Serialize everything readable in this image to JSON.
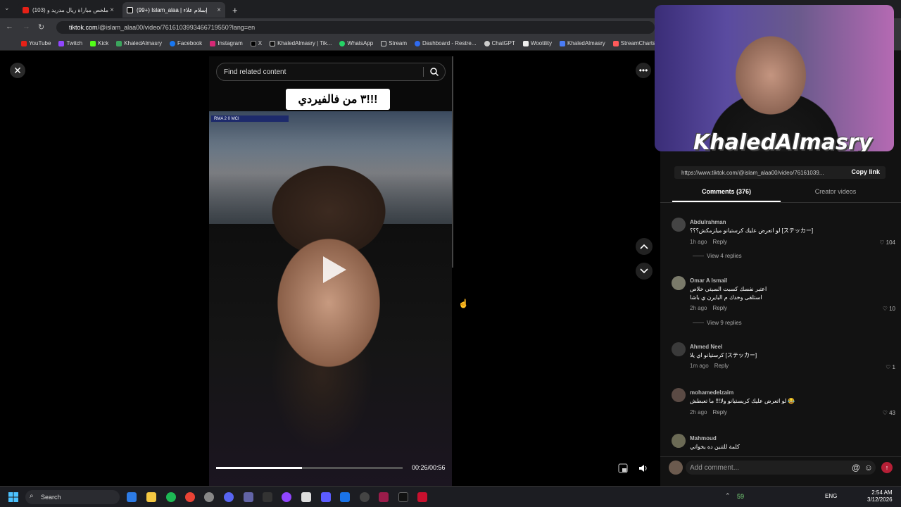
{
  "browser": {
    "tabs": [
      {
        "label": "(103) ملخص مباراة ريال مدريد و",
        "color": "#e62117"
      },
      {
        "label": "(99+) Islam_alaa | إسلام علاء",
        "color": "#ffffff"
      }
    ],
    "new_tab": "+",
    "url_host": "tiktok.com",
    "url_path": "/@islam_alaa00/video/7616103993466719550?lang=en",
    "bookmarks": [
      "YouTube",
      "Twitch",
      "Kick",
      "KhaledAlmasry",
      "Facebook",
      "Instagram",
      "X",
      "KhaledAlmasry | Tik...",
      "WhatsApp",
      "Stream",
      "Dashboard - Restre...",
      "ChatGPT",
      "Wootility",
      "KhaledAlmasry",
      "StreamCharts"
    ]
  },
  "video": {
    "search_placeholder": "Find related content",
    "caption": "٣ من فالفيردي!!!",
    "scorebug": "RMA 2 0 MCI",
    "time": "00:26/00:56",
    "progress": 0.46
  },
  "panel": {
    "link": "https://www.tiktok.com/@islam_alaa00/video/76161039...",
    "copy_link": "Copy link",
    "tab_comments": "Comments (376)",
    "tab_creator": "Creator videos",
    "comment_placeholder": "Add comment...",
    "comments": [
      {
        "user": "Abdulrahman",
        "text": "لو اتعرض عليك كرستيانو ميلزمكش؟؟؟ [ステッカー]",
        "time": "1h ago",
        "reply": "Reply",
        "likes": "104",
        "replies": "View 4 replies"
      },
      {
        "user": "Omar A Ismail",
        "text": "اعتبر نفسك كسبت السيتي خلاص\nاستلقى وخدك م البايرن ي باشا",
        "time": "2h ago",
        "reply": "Reply",
        "likes": "10",
        "replies": "View 9 replies"
      },
      {
        "user": "Ahmed Neel",
        "text": "كرستيانو اي يلا [ステッカー]",
        "time": "1m ago",
        "reply": "Reply",
        "likes": "1",
        "replies": ""
      },
      {
        "user": "mohamedelzaim",
        "text": "لو اتعرض عليك كريستيانو ولا!!! ما تعبطش 😂",
        "time": "2h ago",
        "reply": "Reply",
        "likes": "43",
        "replies": ""
      },
      {
        "user": "Mahmoud",
        "text": "كلمة للتنين ده يخواتي",
        "time": "",
        "reply": "",
        "likes": "",
        "replies": ""
      }
    ]
  },
  "webcam": {
    "name": "KhaledAlmasry"
  },
  "taskbar": {
    "search": "Search",
    "tray_count": "59",
    "lang": "ENG",
    "time": "2:54 AM",
    "date": "3/12/2026"
  }
}
